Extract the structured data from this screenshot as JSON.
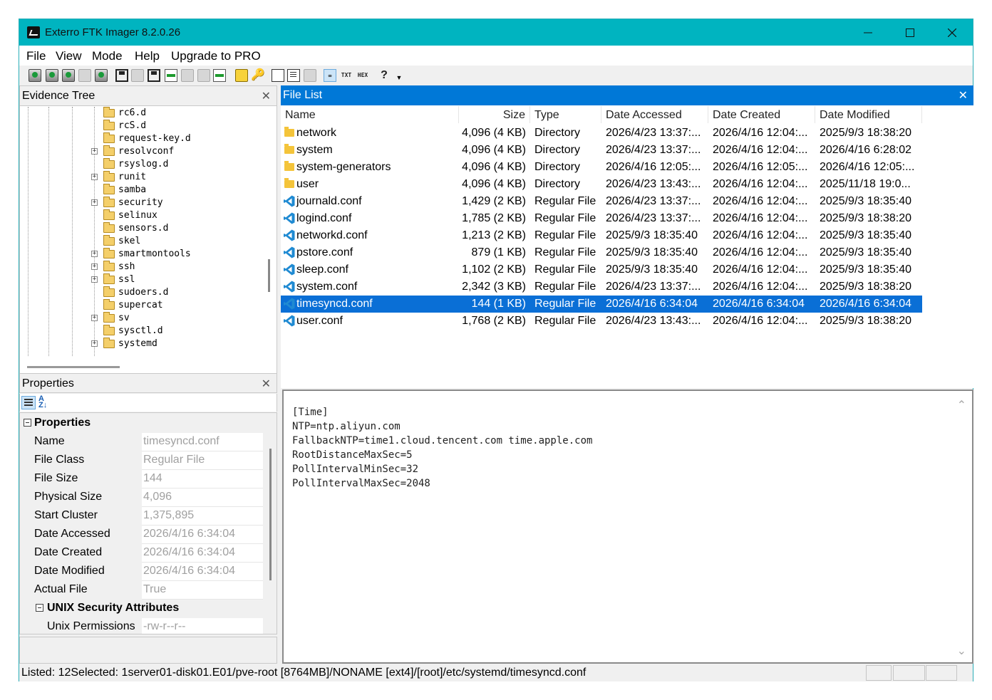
{
  "window": {
    "title": "Exterro FTK Imager 8.2.0.26"
  },
  "menu": {
    "file": "File",
    "view": "View",
    "mode": "Mode",
    "help": "Help",
    "upgrade": "Upgrade to PRO"
  },
  "evidence_tree": {
    "title": "Evidence Tree",
    "items": [
      {
        "label": "rc6.d",
        "expandable": false
      },
      {
        "label": "rcS.d",
        "expandable": false
      },
      {
        "label": "request-key.d",
        "expandable": false
      },
      {
        "label": "resolvconf",
        "expandable": true
      },
      {
        "label": "rsyslog.d",
        "expandable": false
      },
      {
        "label": "runit",
        "expandable": true
      },
      {
        "label": "samba",
        "expandable": false
      },
      {
        "label": "security",
        "expandable": true
      },
      {
        "label": "selinux",
        "expandable": false
      },
      {
        "label": "sensors.d",
        "expandable": false
      },
      {
        "label": "skel",
        "expandable": false
      },
      {
        "label": "smartmontools",
        "expandable": true
      },
      {
        "label": "ssh",
        "expandable": true
      },
      {
        "label": "ssl",
        "expandable": true
      },
      {
        "label": "sudoers.d",
        "expandable": false
      },
      {
        "label": "supercat",
        "expandable": false
      },
      {
        "label": "sv",
        "expandable": true
      },
      {
        "label": "sysctl.d",
        "expandable": false
      },
      {
        "label": "systemd",
        "expandable": true
      }
    ]
  },
  "properties": {
    "title": "Properties",
    "category": "Properties",
    "rows": [
      {
        "key": "Name",
        "value": "timesyncd.conf"
      },
      {
        "key": "File Class",
        "value": "Regular File"
      },
      {
        "key": "File Size",
        "value": "144"
      },
      {
        "key": "Physical Size",
        "value": "4,096"
      },
      {
        "key": "Start Cluster",
        "value": "1,375,895"
      },
      {
        "key": "Date Accessed",
        "value": "2026/4/16 6:34:04"
      },
      {
        "key": "Date Created",
        "value": "2026/4/16 6:34:04"
      },
      {
        "key": "Date Modified",
        "value": "2026/4/16 6:34:04"
      },
      {
        "key": "Actual File",
        "value": "True"
      }
    ],
    "subcategory": "UNIX Security Attributes",
    "sub_rows": [
      {
        "key": "Unix Permissions",
        "value": "-rw-r--r--"
      }
    ]
  },
  "file_list": {
    "title": "File List",
    "columns": [
      "Name",
      "Size",
      "Type",
      "Date Accessed",
      "Date Created",
      "Date Modified"
    ],
    "rows": [
      {
        "icon": "folder-icon",
        "name": "network",
        "size": "4,096 (4 KB)",
        "type": "Directory",
        "accessed": "2026/4/23 13:37:...",
        "created": "2026/4/16 12:04:...",
        "modified": "2025/9/3 18:38:20"
      },
      {
        "icon": "folder-icon",
        "name": "system",
        "size": "4,096 (4 KB)",
        "type": "Directory",
        "accessed": "2026/4/23 13:37:...",
        "created": "2026/4/16 12:04:...",
        "modified": "2026/4/16 6:28:02"
      },
      {
        "icon": "folder-icon",
        "name": "system-generators",
        "size": "4,096 (4 KB)",
        "type": "Directory",
        "accessed": "2026/4/16 12:05:...",
        "created": "2026/4/16 12:05:...",
        "modified": "2026/4/16 12:05:..."
      },
      {
        "icon": "folder-icon",
        "name": "user",
        "size": "4,096 (4 KB)",
        "type": "Directory",
        "accessed": "2026/4/23 13:43:...",
        "created": "2026/4/16 12:04:...",
        "modified": "2025/11/18 19:0..."
      },
      {
        "icon": "vscode-file-icon",
        "name": "journald.conf",
        "size": "1,429 (2 KB)",
        "type": "Regular File",
        "accessed": "2026/4/23 13:37:...",
        "created": "2026/4/16 12:04:...",
        "modified": "2025/9/3 18:35:40"
      },
      {
        "icon": "vscode-file-icon",
        "name": "logind.conf",
        "size": "1,785 (2 KB)",
        "type": "Regular File",
        "accessed": "2026/4/23 13:37:...",
        "created": "2026/4/16 12:04:...",
        "modified": "2025/9/3 18:38:20"
      },
      {
        "icon": "vscode-file-icon",
        "name": "networkd.conf",
        "size": "1,213 (2 KB)",
        "type": "Regular File",
        "accessed": "2025/9/3 18:35:40",
        "created": "2026/4/16 12:04:...",
        "modified": "2025/9/3 18:35:40"
      },
      {
        "icon": "vscode-file-icon",
        "name": "pstore.conf",
        "size": "879 (1 KB)",
        "type": "Regular File",
        "accessed": "2025/9/3 18:35:40",
        "created": "2026/4/16 12:04:...",
        "modified": "2025/9/3 18:35:40"
      },
      {
        "icon": "vscode-file-icon",
        "name": "sleep.conf",
        "size": "1,102 (2 KB)",
        "type": "Regular File",
        "accessed": "2025/9/3 18:35:40",
        "created": "2026/4/16 12:04:...",
        "modified": "2025/9/3 18:35:40"
      },
      {
        "icon": "vscode-file-icon",
        "name": "system.conf",
        "size": "2,342 (3 KB)",
        "type": "Regular File",
        "accessed": "2026/4/23 13:37:...",
        "created": "2026/4/16 12:04:...",
        "modified": "2025/9/3 18:38:20"
      },
      {
        "icon": "vscode-file-icon",
        "name": "timesyncd.conf",
        "size": "144 (1 KB)",
        "type": "Regular File",
        "accessed": "2026/4/16 6:34:04",
        "created": "2026/4/16 6:34:04",
        "modified": "2026/4/16 6:34:04",
        "selected": true
      },
      {
        "icon": "vscode-file-icon",
        "name": "user.conf",
        "size": "1,768 (2 KB)",
        "type": "Regular File",
        "accessed": "2026/4/23 13:43:...",
        "created": "2026/4/16 12:04:...",
        "modified": "2025/9/3 18:38:20"
      }
    ]
  },
  "viewer": {
    "lines": [
      "[Time]",
      "NTP=ntp.aliyun.com",
      "FallbackNTP=time1.cloud.tencent.com time.apple.com",
      "RootDistanceMaxSec=5",
      "PollIntervalMinSec=32",
      "PollIntervalMaxSec=2048"
    ]
  },
  "statusbar": {
    "text": "Listed: 12Selected: 1server01-disk01.E01/pve-root [8764MB]/NONAME [ext4]/[root]/etc/systemd/timesyncd.conf"
  },
  "colors": {
    "titlebar": "#00b4c0",
    "active_panel_header": "#0078d7",
    "selection": "#0a6fd6"
  }
}
